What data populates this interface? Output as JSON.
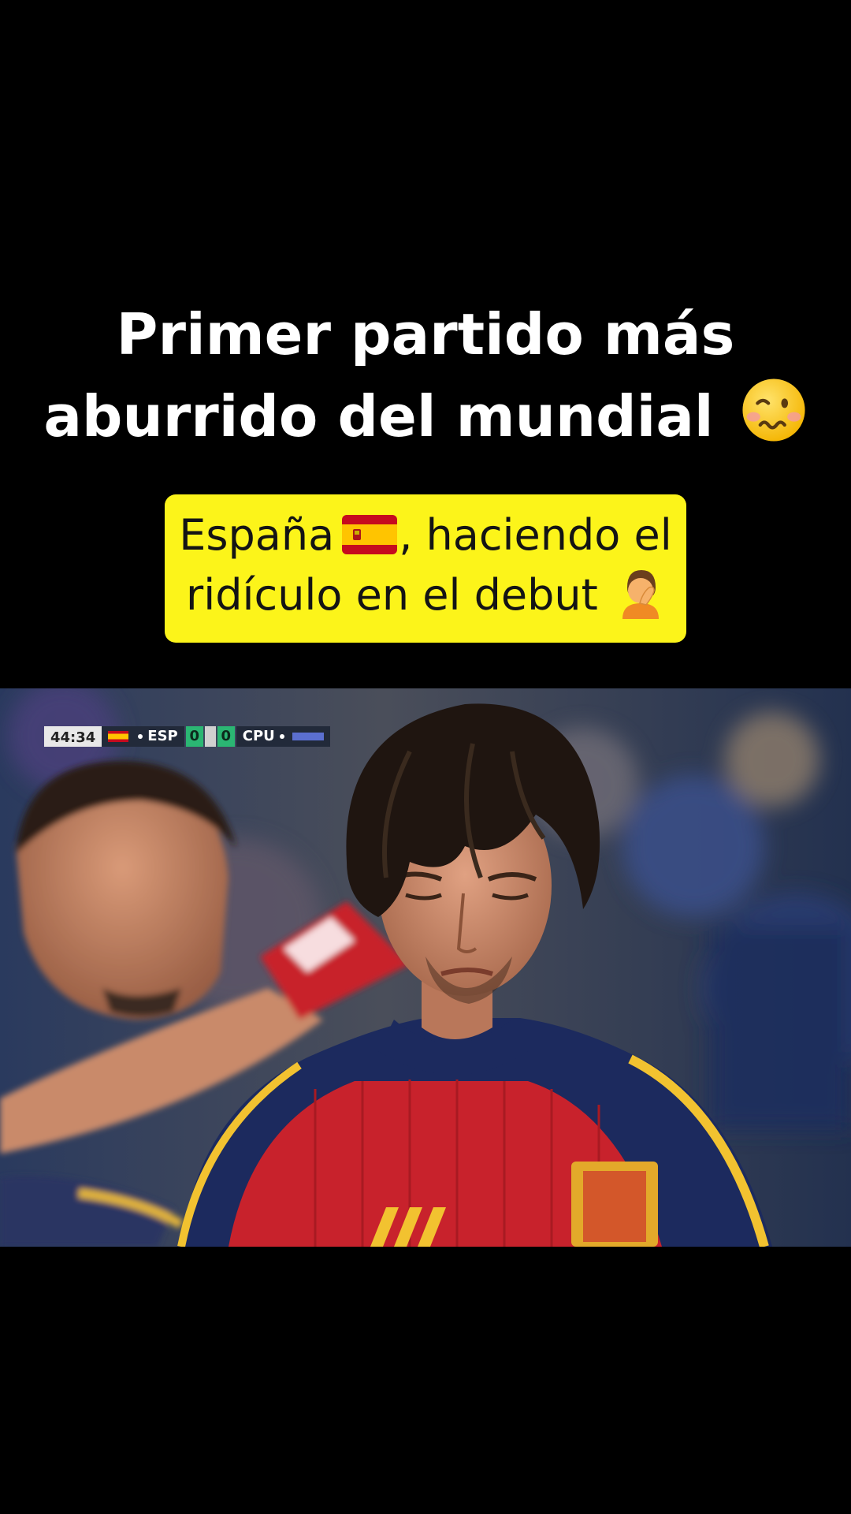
{
  "headline": {
    "line1": "Primer partido más",
    "line2": "aburrido del mundial",
    "emoji": "woozy-face"
  },
  "caption": {
    "line1_text": "España",
    "line1_flag": "spain-flag",
    "line1_rest": ", haciendo el",
    "line2_text": "ridículo en el debut",
    "line2_emoji": "person-facepalming",
    "background_color": "#fcf41a"
  },
  "video": {
    "scorebug": {
      "clock": "44:34",
      "home_team": "ESP",
      "home_score": "0",
      "away_score": "0",
      "away_team": "CPU"
    }
  },
  "colors": {
    "page_background": "#000000",
    "headline_text": "#ffffff",
    "caption_text": "#141414"
  }
}
